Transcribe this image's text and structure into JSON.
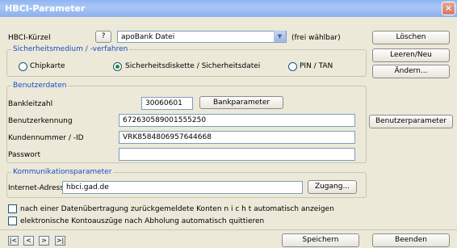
{
  "window": {
    "title": "HBCI-Parameter",
    "close_glyph": "✕"
  },
  "hbci": {
    "label": "HBCI-Kürzel",
    "help_label": "?",
    "value": "apoBank Datei",
    "hint": "(frei wählbar)"
  },
  "security": {
    "legend": "Sicherheitsmedium / -verfahren",
    "options": [
      "Chipkarte",
      "Sicherheitsdiskette / Sicherheitsdatei",
      "PIN / TAN"
    ],
    "selected": "Sicherheitsdiskette / Sicherheitsdatei"
  },
  "user": {
    "legend": "Benutzerdaten",
    "bank_code_label": "Bankleitzahl",
    "bank_code_value": "30060601",
    "bank_params_button": "Bankparameter",
    "user_id_label": "Benutzerkennung",
    "user_id_value": "672630589001555250",
    "customer_label": "Kundennummer / -ID",
    "customer_value": "VRK8584806957644668",
    "password_label": "Passwort",
    "password_value": ""
  },
  "comm": {
    "legend": "Kommunikationsparameter",
    "address_label": "Internet-Adresse",
    "address_value": "hbci.gad.de",
    "access_button": "Zugang..."
  },
  "options": {
    "no_auto_show": "nach einer Datenübertragung zurückgemeldete Konten  n i c h t  automatisch anzeigen",
    "auto_confirm": "elektronische Kontoauszüge nach Abholung automatisch quittieren"
  },
  "side_buttons": {
    "delete": "Löschen",
    "clear_new": "Leeren/Neu",
    "edit": "Ändern...",
    "user_params": "Benutzerparameter"
  },
  "nav": {
    "first": "|<",
    "prev": "<",
    "next": ">",
    "last": ">|"
  },
  "footer": {
    "save": "Speichern",
    "quit": "Beenden"
  }
}
